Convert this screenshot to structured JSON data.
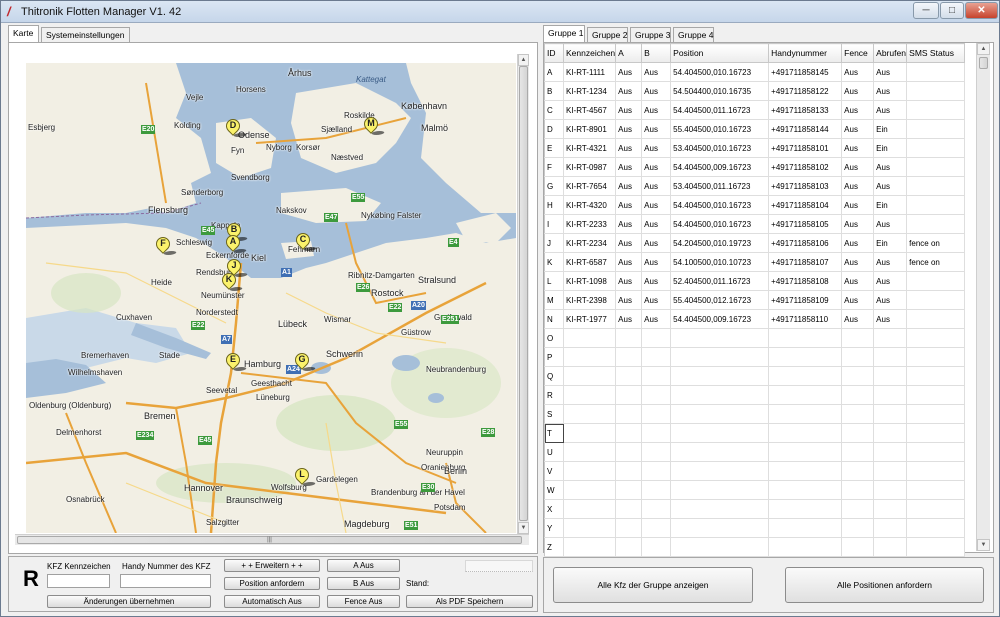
{
  "window": {
    "title": "Thitronik Flotten Manager V1. 42",
    "minimize": "─",
    "maximize": "□",
    "close": "✕"
  },
  "left_tabs": [
    "Karte",
    "Systemeinstellungen"
  ],
  "map": {
    "labels": [
      "Esbjerg",
      "Kolding",
      "Vejle",
      "Horsens",
      "Århus",
      "Odense",
      "Fyn",
      "Nyborg",
      "Korsør",
      "Svendborg",
      "Sjælland",
      "København",
      "Malmö",
      "Roskilde",
      "Næstved",
      "Sønderborg",
      "Flensburg",
      "Nakskov",
      "Nykøbing Falster",
      "Schleswig",
      "Kappeln",
      "Eckernförde",
      "Kiel",
      "Fehmarn",
      "Heide",
      "Rendsburg",
      "Neumünster",
      "Ribnitz-Damgarten",
      "Rostock",
      "Stralsund",
      "Greifswald",
      "Cuxhaven",
      "Norderstedt",
      "Lübeck",
      "Wismar",
      "Güstrow",
      "Neubrandenburg",
      "Bremerhaven",
      "Wilhelmshaven",
      "Stade",
      "Hamburg",
      "Schwerin",
      "Oldenburg (Oldenburg)",
      "Bremen",
      "Delmenhorst",
      "Seevetal",
      "Geesthacht",
      "Lüneburg",
      "Neuruppin",
      "Oranienburg",
      "Hannover",
      "Braunschweig",
      "Salzgitter",
      "Wolfsburg",
      "Gardelegen",
      "Brandenburg an der Havel",
      "Berlin",
      "Osnabrück",
      "Magdeburg",
      "Potsdam",
      "Kattegat"
    ],
    "markers": [
      {
        "letter": "D"
      },
      {
        "letter": "M"
      },
      {
        "letter": "B"
      },
      {
        "letter": "A"
      },
      {
        "letter": "F"
      },
      {
        "letter": "C"
      },
      {
        "letter": "J"
      },
      {
        "letter": "K"
      },
      {
        "letter": "E"
      },
      {
        "letter": "G"
      },
      {
        "letter": "L"
      }
    ],
    "roads": [
      "E20",
      "E45",
      "E55",
      "E47",
      "E22",
      "E251",
      "A1",
      "E26",
      "E28",
      "E55",
      "E234",
      "E45",
      "E51",
      "A7",
      "A24",
      "A20",
      "E22",
      "E4",
      "E30"
    ]
  },
  "hscroll_grip": "|||",
  "controls": {
    "kfz_label": "KFZ Kennzeichen",
    "handy_label": "Handy Nummer des KFZ",
    "badge": "R",
    "erweitern": "+ + Erweitern + +",
    "position_anfordern": "Position anfordern",
    "automatisch_aus": "Automatisch Aus",
    "a_aus": "A Aus",
    "b_aus": "B Aus",
    "fence_aus": "Fence Aus",
    "stand_label": "Stand:",
    "aenderungen": "Änderungen übernehmen",
    "pdf": "Als PDF Speichern"
  },
  "right_tabs": [
    "Gruppe 1",
    "Gruppe 2",
    "Gruppe 3",
    "Gruppe 4"
  ],
  "table": {
    "headers": [
      "ID",
      "Kennzeichen",
      "A",
      "B",
      "Position",
      "Handynummer",
      "Fence",
      "Abrufen",
      "SMS Status"
    ],
    "rows": [
      [
        "A",
        "KI-RT-1111",
        "Aus",
        "Aus",
        "54.404500,010.16723",
        "+491711858145",
        "Aus",
        "Aus",
        ""
      ],
      [
        "B",
        "KI-RT-1234",
        "Aus",
        "Aus",
        "54.504400,010.16735",
        "+491711858122",
        "Aus",
        "Aus",
        ""
      ],
      [
        "C",
        "KI-RT-4567",
        "Aus",
        "Aus",
        "54.404500,011.16723",
        "+491711858133",
        "Aus",
        "Aus",
        ""
      ],
      [
        "D",
        "KI-RT-8901",
        "Aus",
        "Aus",
        "55.404500,010.16723",
        "+491711858144",
        "Aus",
        "Ein",
        ""
      ],
      [
        "E",
        "KI-RT-4321",
        "Aus",
        "Aus",
        "53.404500,010.16723",
        "+491711858101",
        "Aus",
        "Ein",
        ""
      ],
      [
        "F",
        "KI-RT-0987",
        "Aus",
        "Aus",
        "54.404500,009.16723",
        "+491711858102",
        "Aus",
        "Aus",
        ""
      ],
      [
        "G",
        "KI-RT-7654",
        "Aus",
        "Aus",
        "53.404500,011.16723",
        "+491711858103",
        "Aus",
        "Aus",
        ""
      ],
      [
        "H",
        "KI-RT-4320",
        "Aus",
        "Aus",
        "54.404500,010.16723",
        "+491711858104",
        "Aus",
        "Ein",
        ""
      ],
      [
        "I",
        "KI-RT-2233",
        "Aus",
        "Aus",
        "54.404500,010.16723",
        "+491711858105",
        "Aus",
        "Aus",
        ""
      ],
      [
        "J",
        "KI-RT-2234",
        "Aus",
        "Aus",
        "54.204500,010.19723",
        "+491711858106",
        "Aus",
        "Ein",
        "fence on"
      ],
      [
        "K",
        "KI-RT-6587",
        "Aus",
        "Aus",
        "54.100500,010.10723",
        "+491711858107",
        "Aus",
        "Aus",
        "fence on"
      ],
      [
        "L",
        "KI-RT-1098",
        "Aus",
        "Aus",
        "52.404500,011.16723",
        "+491711858108",
        "Aus",
        "Aus",
        ""
      ],
      [
        "M",
        "KI-RT-2398",
        "Aus",
        "Aus",
        "55.404500,012.16723",
        "+491711858109",
        "Aus",
        "Aus",
        ""
      ],
      [
        "N",
        "KI-RT-1977",
        "Aus",
        "Aus",
        "54.404500,009.16723",
        "+491711858110",
        "Aus",
        "Aus",
        ""
      ],
      [
        "O",
        "",
        "",
        "",
        "",
        "",
        "",
        "",
        ""
      ],
      [
        "P",
        "",
        "",
        "",
        "",
        "",
        "",
        "",
        ""
      ],
      [
        "Q",
        "",
        "",
        "",
        "",
        "",
        "",
        "",
        ""
      ],
      [
        "R",
        "",
        "",
        "",
        "",
        "",
        "",
        "",
        ""
      ],
      [
        "S",
        "",
        "",
        "",
        "",
        "",
        "",
        "",
        ""
      ],
      [
        "T",
        "",
        "",
        "",
        "",
        "",
        "",
        "",
        ""
      ],
      [
        "U",
        "",
        "",
        "",
        "",
        "",
        "",
        "",
        ""
      ],
      [
        "V",
        "",
        "",
        "",
        "",
        "",
        "",
        "",
        ""
      ],
      [
        "W",
        "",
        "",
        "",
        "",
        "",
        "",
        "",
        ""
      ],
      [
        "X",
        "",
        "",
        "",
        "",
        "",
        "",
        "",
        ""
      ],
      [
        "Y",
        "",
        "",
        "",
        "",
        "",
        "",
        "",
        ""
      ],
      [
        "Z",
        "",
        "",
        "",
        "",
        "",
        "",
        "",
        ""
      ]
    ]
  },
  "bottom_buttons": {
    "show_all": "Alle Kfz der Gruppe anzeigen",
    "request_all": "Alle Positionen anfordern"
  },
  "colors": {
    "land": "#f2efe4",
    "water": "#a6bfd9",
    "marker": "#fbf26b",
    "title_gradient_top": "#dbe6f3"
  }
}
